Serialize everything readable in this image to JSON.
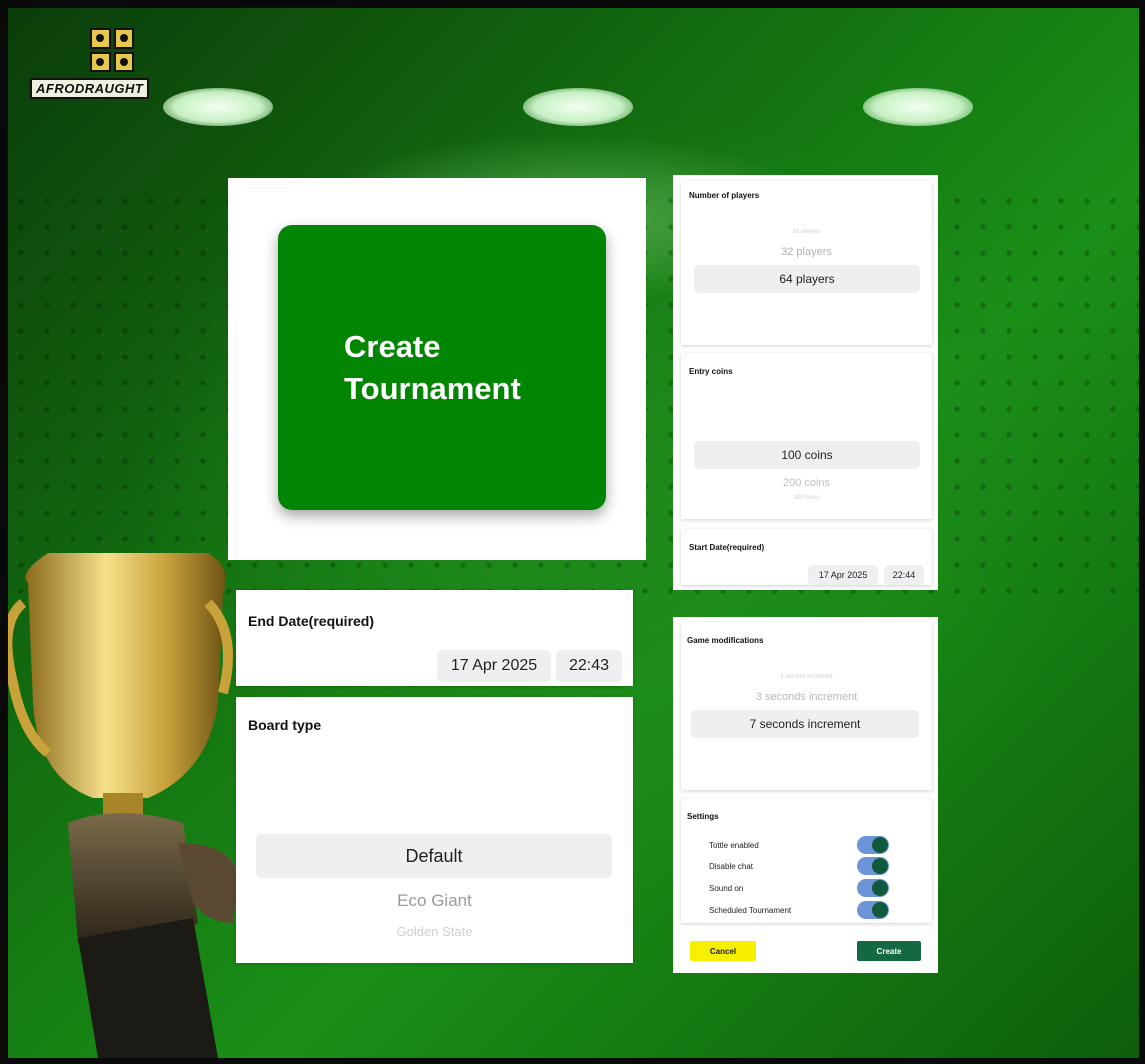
{
  "logo": {
    "text": "AFRODRAUGHT"
  },
  "hero": {
    "title": "Create Tournament"
  },
  "end_date": {
    "label": "End Date(required)",
    "date": "17 Apr 2025",
    "time": "22:43"
  },
  "board_type": {
    "label": "Board type",
    "selected": "Default",
    "options_after": [
      "Eco Giant",
      "Golden State"
    ]
  },
  "players": {
    "label": "Number of players",
    "options_before": [
      "16 players",
      "32 players"
    ],
    "selected": "64 players"
  },
  "entry": {
    "label": "Entry coins",
    "selected": "100 coins",
    "options_after": [
      "200 coins",
      "300 coins"
    ]
  },
  "start_date": {
    "label": "Start Date(required)",
    "date": "17 Apr 2025",
    "time": "22:44"
  },
  "mods": {
    "label": "Game modifications",
    "options_before": [
      "1 second increment",
      "3 seconds increment"
    ],
    "selected": "7 seconds increment"
  },
  "settings": {
    "label": "Settings",
    "items": [
      {
        "label": "Tottle enabled",
        "on": true
      },
      {
        "label": "Disable chat",
        "on": true
      },
      {
        "label": "Sound on",
        "on": true
      },
      {
        "label": "Scheduled Tournament",
        "on": true
      }
    ]
  },
  "actions": {
    "cancel": "Cancel",
    "create": "Create"
  },
  "colors": {
    "primary_green": "#028502",
    "create_button": "#136a42",
    "cancel_button": "#f6f000",
    "toggle_track": "#6d93d8"
  }
}
